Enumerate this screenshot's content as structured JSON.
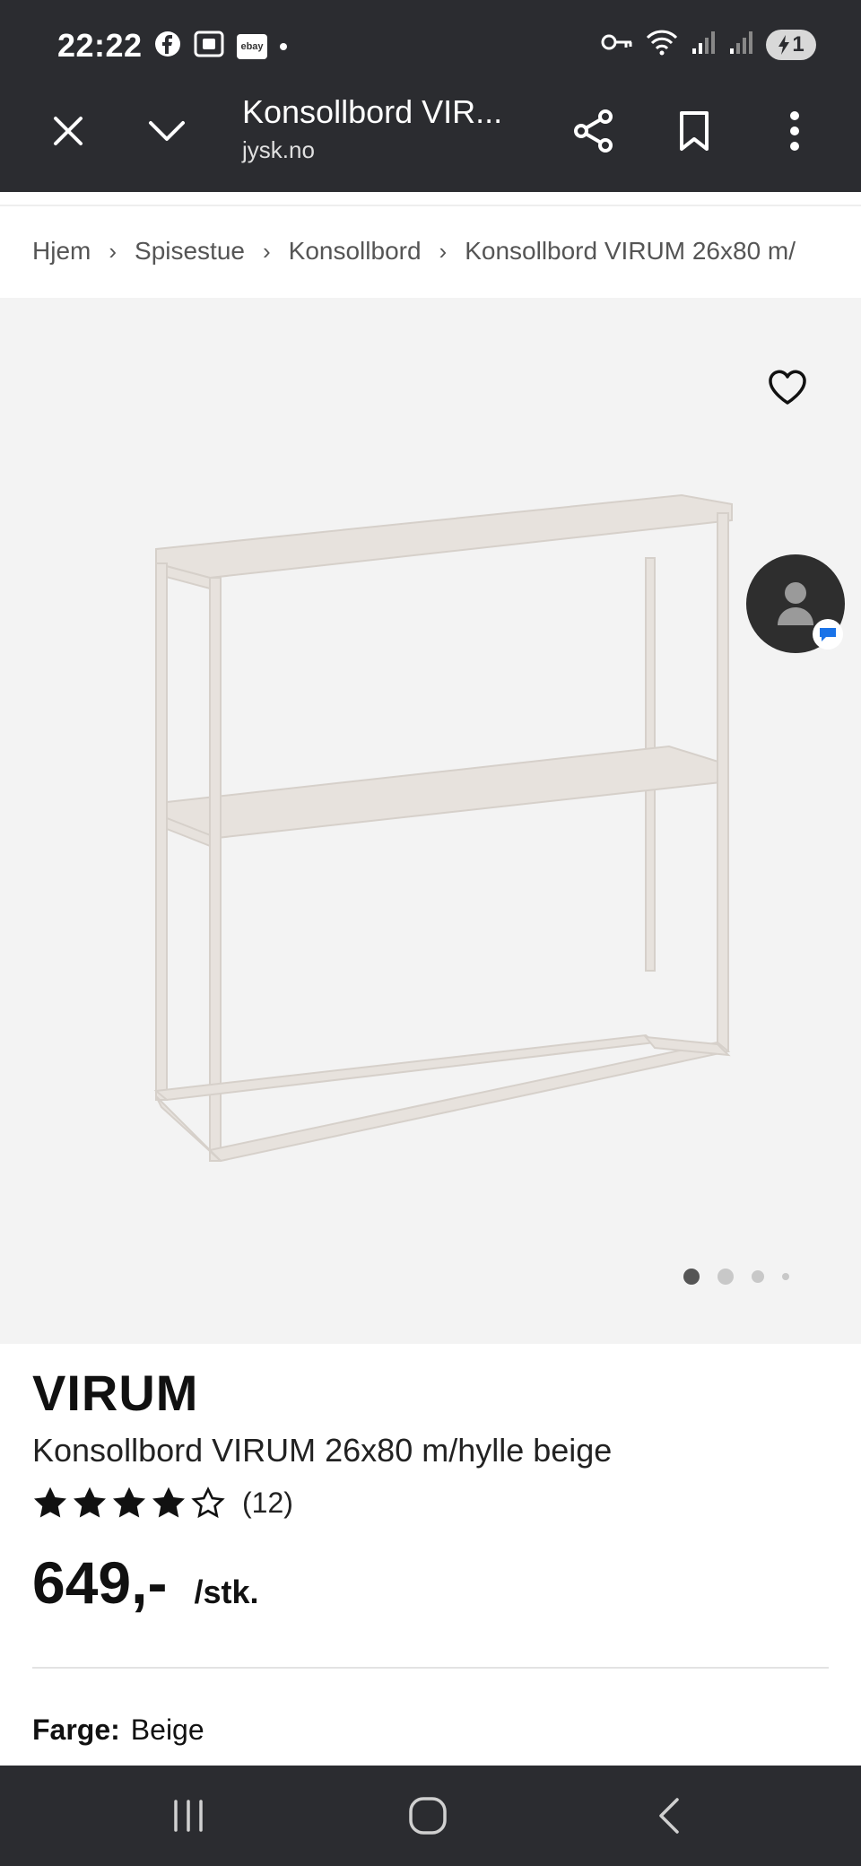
{
  "status_bar": {
    "time": "22:22",
    "left_icons": [
      "facebook-icon",
      "screenshot-icon",
      "ebay-icon",
      "notification-dot"
    ],
    "ebay_label": "ebay",
    "right_icons": [
      "vpn-key-icon",
      "wifi-icon",
      "signal-icon",
      "signal-icon-2",
      "battery-icon"
    ],
    "battery_label": "1"
  },
  "browser": {
    "title": "Konsollbord VIR...",
    "url": "jysk.no",
    "actions": [
      "close-icon",
      "chevron-down-icon",
      "share-icon",
      "bookmark-icon",
      "more-vert-icon"
    ]
  },
  "breadcrumb": {
    "items": [
      "Hjem",
      "Spisestue",
      "Konsollbord",
      "Konsollbord VIRUM 26x80 m/"
    ]
  },
  "gallery": {
    "image_count": 4,
    "active_index": 0
  },
  "product": {
    "brand": "VIRUM",
    "name": "Konsollbord VIRUM 26x80 m/hylle beige",
    "rating": 4,
    "rating_max": 5,
    "rating_count": "(12)",
    "price": "649,-",
    "unit": "/stk.",
    "color_label": "Farge:",
    "color_value": "Beige"
  },
  "colors": {
    "system_bar": "#2b2c30",
    "hero_bg": "#f3f3f3",
    "accent_chat": "#1a73e8",
    "product_beige": "#e6e1dc"
  },
  "nav_bar": {
    "buttons": [
      "recents-icon",
      "home-icon",
      "back-icon"
    ]
  }
}
